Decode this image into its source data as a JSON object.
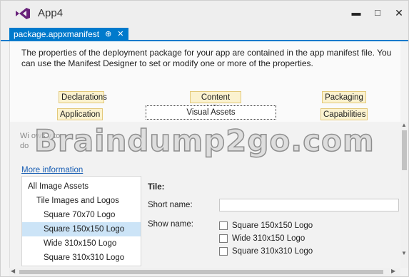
{
  "window": {
    "title": "App4",
    "minimize_glyph": "▬",
    "maximize_glyph": "□",
    "close_glyph": "✕"
  },
  "tab": {
    "label": "package.appxmanifest",
    "pin_glyph": "⊕",
    "close_glyph": "✕"
  },
  "description": "The properties of the deployment package for your app are contained in the app manifest file. You can use the Manifest Designer to set or modify one or more of the properties.",
  "nav_tabs": {
    "declarations": "Declarations",
    "content_uris": "Content URIs",
    "packaging": "Packaging",
    "application": "Application",
    "visual_assets": "Visual Assets",
    "capabilities": "Capabilities"
  },
  "faint_text": {
    "line1": "Wi                                                                                       ows                              y to",
    "line2": "do                                                                                                                         "
  },
  "watermark": "Braindump2go.com",
  "more_information": "More information",
  "asset_list": {
    "items": [
      "All Image Assets",
      "Tile Images and Logos",
      "Square 70x70 Logo",
      "Square 150x150 Logo",
      "Wide 310x150 Logo",
      "Square 310x310 Logo"
    ],
    "selected_index": 3
  },
  "form": {
    "tile_heading": "Tile:",
    "short_name_label": "Short name:",
    "short_name_value": "",
    "show_name_label": "Show name:",
    "show_name_options": [
      {
        "label": "Square 150x150 Logo",
        "checked": false
      },
      {
        "label": "Wide 310x150 Logo",
        "checked": false
      },
      {
        "label": "Square 310x310 Logo",
        "checked": false
      }
    ]
  },
  "scrollbar": {
    "up": "▲",
    "down": "▼",
    "left": "◀",
    "right": "▶"
  },
  "colors": {
    "accent": "#007acc",
    "tab_highlight": "#fbf2cf",
    "selection": "#cce4f7",
    "link": "#1a5fb4",
    "vs_logo": "#68217a"
  },
  "icons": [
    "visual-studio-logo-icon",
    "pin-icon",
    "close-icon"
  ]
}
